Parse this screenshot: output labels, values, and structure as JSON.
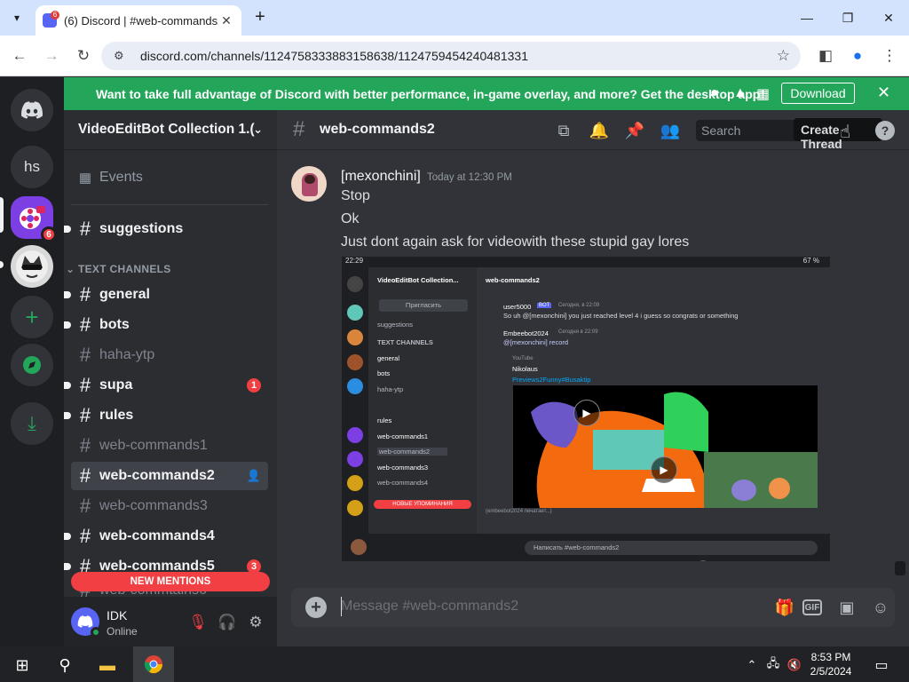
{
  "browser": {
    "tab_title": "(6) Discord | #web-commands2",
    "tab_close": "✕",
    "new_tab": "+",
    "url": "discord.com/channels/1124758333883158638/1124759454240481331",
    "window": {
      "minimize": "—",
      "maximize": "❐",
      "close": "✕"
    }
  },
  "servers": {
    "items": [
      {
        "label": "",
        "icon": "discord-home-icon"
      },
      {
        "label": "hs",
        "icon": "server-initials-icon"
      },
      {
        "label": "",
        "icon": "video-edit-server-icon",
        "badge": "6"
      },
      {
        "label": "",
        "icon": "sunglasses-cat-server-icon"
      },
      {
        "label": "+",
        "icon": "add-server-icon"
      },
      {
        "label": "",
        "icon": "explore-servers-icon"
      },
      {
        "label": "",
        "icon": "download-apps-icon"
      }
    ]
  },
  "banner": {
    "message": "Want to take full advantage of Discord with better performance, in-game overlay, and more? Get the desktop app!",
    "download_label": "Download",
    "close": "✕"
  },
  "channel_list": {
    "server_name": "VideoEditBot Collection 1.(",
    "events_label": "Events",
    "suggestions": "suggestions",
    "category": "TEXT CHANNELS",
    "channels": [
      {
        "name": "general",
        "state": "unread",
        "dot": true
      },
      {
        "name": "bots",
        "state": "unread",
        "dot": true
      },
      {
        "name": "haha-ytp",
        "state": "muted"
      },
      {
        "name": "supa",
        "state": "unread",
        "dot": true,
        "mentions": "1"
      },
      {
        "name": "rules",
        "state": "unread",
        "dot": true
      },
      {
        "name": "web-commands1",
        "state": "muted"
      },
      {
        "name": "web-commands2",
        "state": "active"
      },
      {
        "name": "web-commands3",
        "state": "muted"
      },
      {
        "name": "web-commands4",
        "state": "unread",
        "dot": true
      },
      {
        "name": "web-commands5",
        "state": "unread",
        "dot": true,
        "mentions": "3"
      },
      {
        "name": "web-commtains6",
        "state": "muted"
      }
    ],
    "new_mentions": "NEW MENTIONS",
    "user": {
      "name": "IDK",
      "status": "Online"
    }
  },
  "chat": {
    "channel_name": "web-commands2",
    "search_placeholder": "Search",
    "tooltip": "Create Thread",
    "help": "?",
    "message": {
      "author": "[mexonchini]",
      "timestamp": "Today at 12:30 PM",
      "lines": [
        "Stop",
        "Ok",
        "Just dont again ask for videowith these stupid gay lores"
      ]
    },
    "composer_placeholder": "Message #web-commands2",
    "gif_label": "GIF"
  },
  "attachment": {
    "status_time": "22:29",
    "battery": "67 %",
    "server_name": "VideoEditBot Collection...",
    "invite_button": "Пригласить",
    "suggestions": "suggestions",
    "category": "TEXT CHANNELS",
    "channels": [
      "general",
      "bots",
      "haha-ytp",
      "rules",
      "web-commands1",
      "web-commands2",
      "web-commands3",
      "web-commands4"
    ],
    "new_mentions": "НОВЫЕ УПОМИНАНИЯ",
    "channel_title": "web-commands2",
    "msg1_author": "user5000",
    "msg1_bot": "BOT",
    "msg1_time": "Сегодня, в 22:09",
    "msg1_text": "So uh @[mexonchini] you just reached level 4 i guess so congrats or something",
    "msg2_author": "Embeebot2024",
    "msg2_time": "Сегодня в 22:09",
    "msg2_text": "@[mexonchini] record",
    "embed_site": "YouTube",
    "embed_author": "Nikolaus",
    "embed_title": "Previews2Funny#Busaktip",
    "reply_hint": "(embeebot2024 печатает...)",
    "composer": "Написать #web-commands2",
    "colors": {
      "orange": "#f46a0f",
      "green": "#2fd15b",
      "purple": "#6b57c7",
      "teal": "#5fc8b6"
    }
  },
  "taskbar": {
    "time": "8:53 PM",
    "date": "2/5/2024"
  },
  "colors": {
    "blurple": "#5865f2",
    "green": "#23a55a",
    "red": "#f23f43",
    "bg_dark": "#1e1f22",
    "bg_sidebar": "#2b2d31",
    "bg_chat": "#313338"
  }
}
